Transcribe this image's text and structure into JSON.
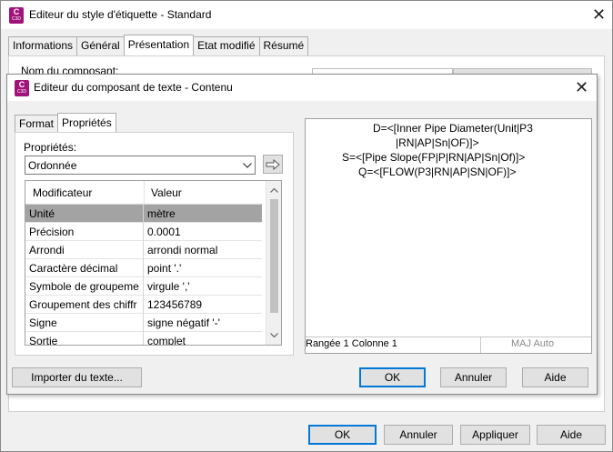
{
  "outer": {
    "title": "Editeur du style d'étiquette - Standard",
    "tabs": [
      "Informations",
      "Général",
      "Présentation",
      "Etat modifié",
      "Résumé"
    ],
    "component_name_label": "Nom du composant:",
    "buttons": {
      "ok": "OK",
      "cancel": "Annuler",
      "apply": "Appliquer",
      "help": "Aide"
    }
  },
  "inner": {
    "title": "Editeur du composant de texte - Contenu",
    "tabs": [
      "Format",
      "Propriétés"
    ],
    "properties_label": "Propriétés:",
    "properties_selected": "Ordonnée",
    "grid_headers": [
      "Modificateur",
      "Valeur"
    ],
    "grid_rows": [
      {
        "name": "Unité",
        "value": "mètre"
      },
      {
        "name": "Précision",
        "value": "0.0001"
      },
      {
        "name": "Arrondi",
        "value": "arrondi normal"
      },
      {
        "name": "Caractère décimal",
        "value": "point '.'"
      },
      {
        "name": "Symbole de groupeme",
        "value": "virgule ','"
      },
      {
        "name": "Groupement des chiffr",
        "value": "123456789"
      },
      {
        "name": "Signe",
        "value": "signe négatif '-'"
      },
      {
        "name": "Sortie",
        "value": "complet"
      }
    ],
    "preview_lines": [
      "D=<[Inner Pipe Diameter(Unit|P3",
      "|RN|AP|Sn|OF)]>",
      "S=<[Pipe Slope(FP|P|RN|AP|Sn|Of)]>",
      "Q=<[FLOW(P3|RN|AP|SN|OF)]>"
    ],
    "status_position": "Rangée 1 Colonne 1",
    "status_caps": "MAJ Auto",
    "buttons": {
      "import": "Importer du texte...",
      "ok": "OK",
      "cancel": "Annuler",
      "help": "Aide"
    }
  },
  "app_icon": {
    "letter": "C",
    "sub": "C3D",
    "color": "#a0137a"
  },
  "colors": {
    "selected_row": "#a3a3a3",
    "focus_border": "#0078d7"
  }
}
